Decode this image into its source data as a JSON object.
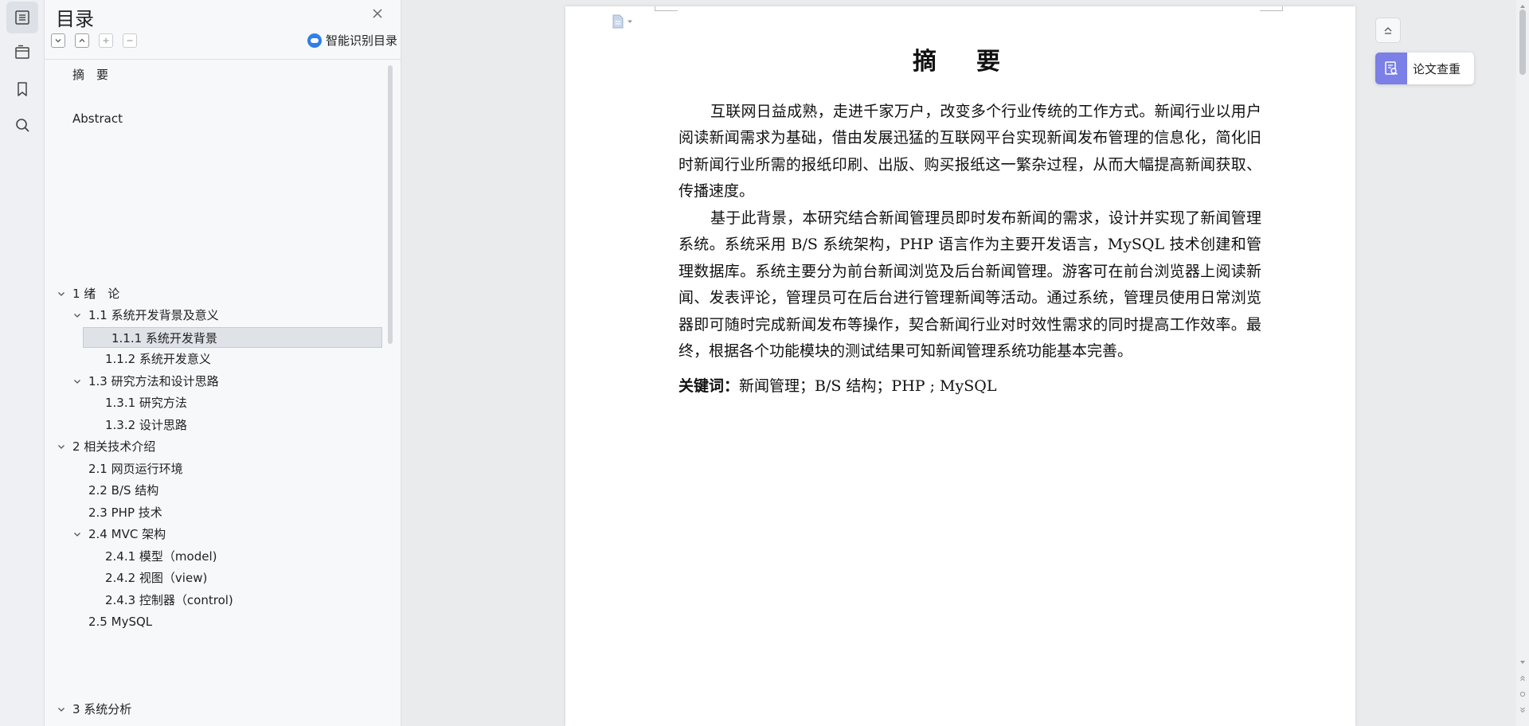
{
  "toc": {
    "title": "目录",
    "smart_label": "智能识别目录",
    "items": [
      {
        "label": "摘　要",
        "level": 0,
        "chevron": false,
        "selected": false
      },
      {
        "label": "Abstract",
        "level": 0,
        "chevron": false,
        "selected": false
      },
      {
        "label": "1  绪　论",
        "level": 0,
        "chevron": true,
        "selected": false
      },
      {
        "label": "1.1  系统开发背景及意义",
        "level": 1,
        "chevron": true,
        "selected": false
      },
      {
        "label": "1.1.1  系统开发背景",
        "level": 2,
        "chevron": false,
        "selected": true
      },
      {
        "label": "1.1.2  系统开发意义",
        "level": 2,
        "chevron": false,
        "selected": false
      },
      {
        "label": "1.3  研究方法和设计思路",
        "level": 1,
        "chevron": true,
        "selected": false
      },
      {
        "label": "1.3.1 研究方法",
        "level": 2,
        "chevron": false,
        "selected": false
      },
      {
        "label": "1.3.2 设计思路",
        "level": 2,
        "chevron": false,
        "selected": false
      },
      {
        "label": "2  相关技术介绍",
        "level": 0,
        "chevron": true,
        "selected": false
      },
      {
        "label": "2.1 网页运行环境",
        "level": 1,
        "chevron": false,
        "selected": false
      },
      {
        "label": "2.2 B/S 结构",
        "level": 1,
        "chevron": false,
        "selected": false
      },
      {
        "label": "2.3 PHP 技术",
        "level": 1,
        "chevron": false,
        "selected": false
      },
      {
        "label": "2.4 MVC 架构",
        "level": 1,
        "chevron": true,
        "selected": false
      },
      {
        "label": "2.4.1 模型（model)",
        "level": 2,
        "chevron": false,
        "selected": false
      },
      {
        "label": "2.4.2 视图（view)",
        "level": 2,
        "chevron": false,
        "selected": false
      },
      {
        "label": "2.4.3 控制器（control)",
        "level": 2,
        "chevron": false,
        "selected": false
      },
      {
        "label": "2.5 MySQL",
        "level": 1,
        "chevron": false,
        "selected": false
      },
      {
        "label": "3 系统分析",
        "level": 0,
        "chevron": true,
        "selected": false
      }
    ]
  },
  "document": {
    "title": "摘　要",
    "paragraphs": [
      "互联网日益成熟，走进千家万户，改变多个行业传统的工作方式。新闻行业以用户阅读新闻需求为基础，借由发展迅猛的互联网平台实现新闻发布管理的信息化，简化旧时新闻行业所需的报纸印刷、出版、购买报纸这一繁杂过程，从而大幅提高新闻获取、传播速度。",
      "基于此背景，本研究结合新闻管理员即时发布新闻的需求，设计并实现了新闻管理系统。系统采用 B/S 系统架构，PHP 语言作为主要开发语言，MySQL 技术创建和管理数据库。系统主要分为前台新闻浏览及后台新闻管理。游客可在前台浏览器上阅读新闻、发表评论，管理员可在后台进行管理新闻等活动。通过系统，管理员使用日常浏览器即可随时完成新闻发布等操作，契合新闻行业对时效性需求的同时提高工作效率。最终，根据各个功能模块的测试结果可知新闻管理系统功能基本完善。"
    ],
    "keywords_label": "关键词：",
    "keywords": "新闻管理；B/S 结构；PHP ; MySQL"
  },
  "right": {
    "check_label": "论文查重"
  },
  "colors": {
    "accent": "#7b7fe6",
    "smart_blue": "#2f7fe8",
    "selected_bg": "#dfe3e8"
  }
}
